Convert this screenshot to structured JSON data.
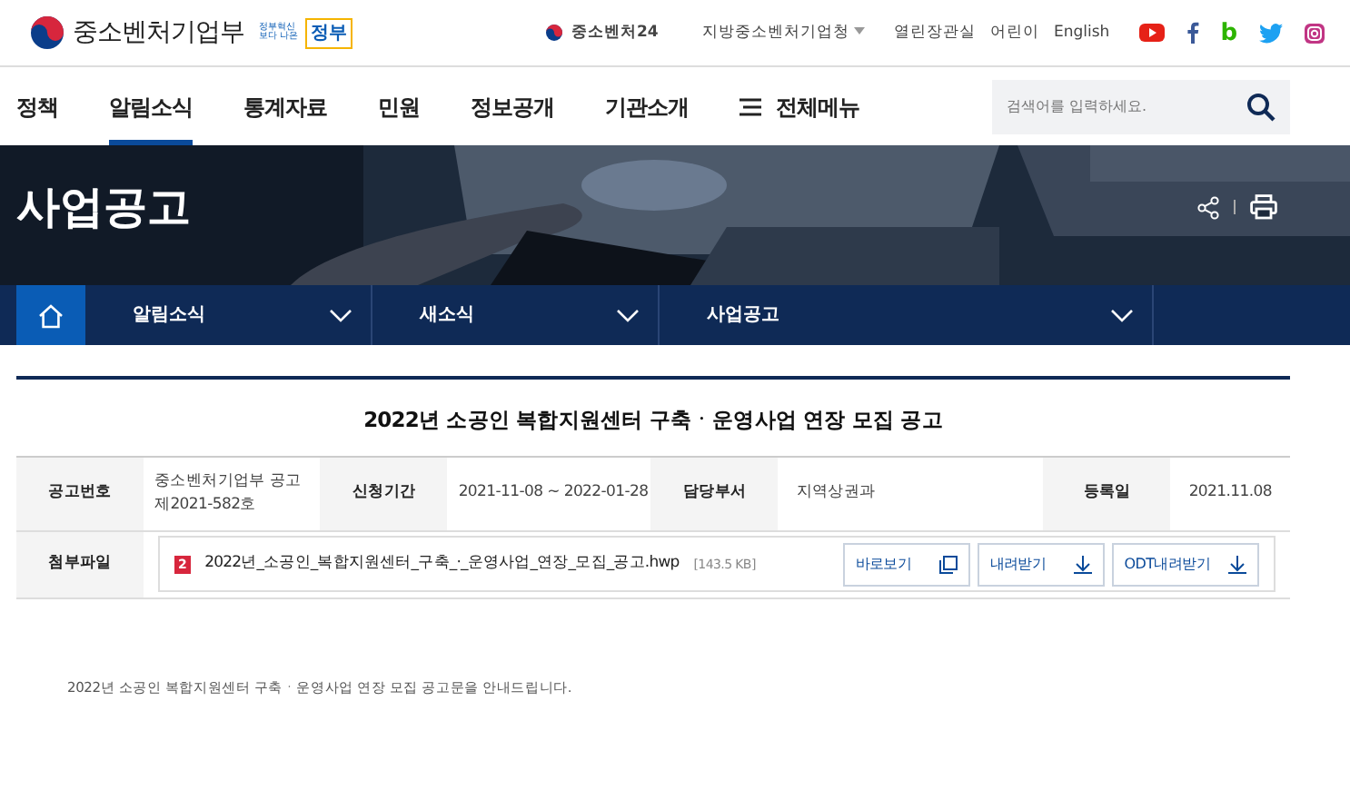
{
  "header": {
    "logo_text": "중소벤처기업부",
    "slogan": [
      "정부혁신",
      "보다 나은",
      "정부"
    ],
    "top_links": [
      {
        "text": "중소벤처24",
        "kind": "brand"
      },
      {
        "text": "지방중소벤처기업청",
        "kind": "dropdown"
      },
      {
        "text": "열린장관실",
        "kind": "link"
      },
      {
        "text": "어린이",
        "kind": "link"
      },
      {
        "text": "English",
        "kind": "link"
      }
    ],
    "blog_mark": "b"
  },
  "nav": {
    "items": [
      {
        "label": "정책",
        "selected": false
      },
      {
        "label": "알림소식",
        "selected": true
      },
      {
        "label": "통계자료",
        "selected": false
      },
      {
        "label": "민원",
        "selected": false
      },
      {
        "label": "정보공개",
        "selected": false
      },
      {
        "label": "기관소개",
        "selected": false
      }
    ],
    "all_menu": "전체메뉴",
    "search": {
      "placeholder": "검색어를 입력하세요."
    }
  },
  "hero": {
    "title": "사업공고"
  },
  "breadcrumb": [
    "알림소식",
    "새소식",
    "사업공고"
  ],
  "notice": {
    "title": "2022년 소공인 복합지원센터 구축ㆍ운영사업 연장 모집 공고",
    "fields": [
      {
        "label": "공고번호",
        "value": "중소벤처기업부 공고 제2021-582호"
      },
      {
        "label": "신청기간",
        "value": "2021-11-08 ~ 2022-01-28"
      },
      {
        "label": "담당부서",
        "value": "지역상권과"
      },
      {
        "label": "등록일",
        "value": "2021.11.08"
      }
    ],
    "attachment": {
      "label": "첨부파일",
      "file_badge": "2",
      "file_name": "2022년_소공인_복합지원센터_구축_·_운영사업_연장_모집_공고.hwp",
      "size": "[143.5 KB]",
      "buttons": [
        "바로보기",
        "내려받기",
        "ODT내려받기"
      ]
    },
    "description": "2022년 소공인 복합지원센터 구축ㆍ운영사업 연장 모집 공고문을 안내드립니다."
  }
}
